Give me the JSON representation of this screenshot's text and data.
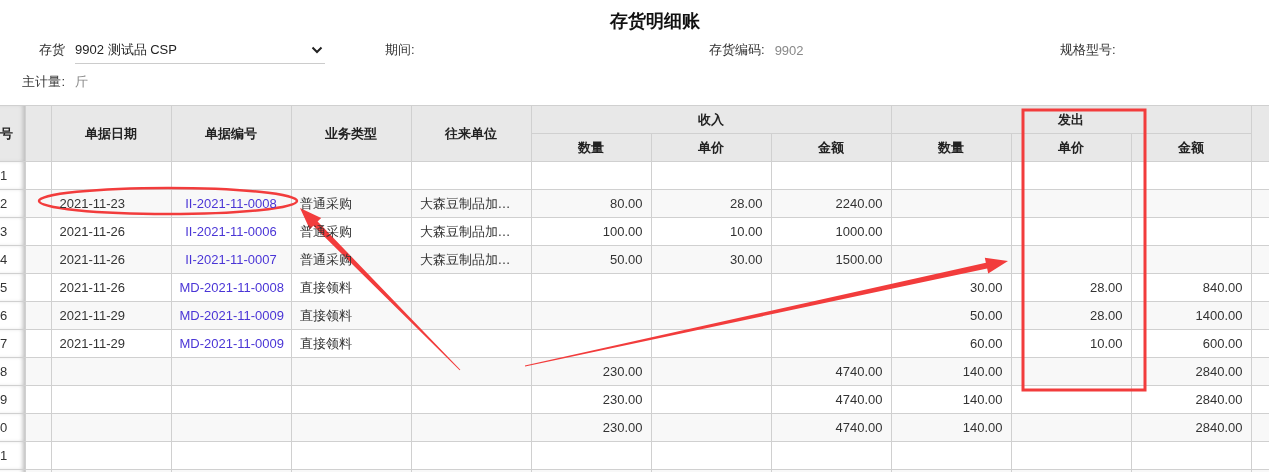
{
  "title": "存货明细账",
  "filters": {
    "inventory": {
      "label": "存货",
      "value": "9902 测试品 CSP"
    },
    "period": {
      "label": "期间:"
    },
    "code": {
      "label": "存货编码:",
      "value": "9902"
    },
    "spec": {
      "label": "规格型号:"
    },
    "unit": {
      "label": "主计量:",
      "value": "斤"
    }
  },
  "table": {
    "row_number_header": "号",
    "columns": [
      "单据日期",
      "单据编号",
      "业务类型",
      "往来单位"
    ],
    "groups": [
      {
        "label": "收入",
        "columns": [
          "数量",
          "单价",
          "金额"
        ]
      },
      {
        "label": "发出",
        "columns": [
          "数量",
          "单价",
          "金额"
        ]
      }
    ],
    "rows": [
      {
        "no": "1"
      },
      {
        "no": "2",
        "date": "2021-11-23",
        "doc_no": "II-2021-11-0008",
        "type": "普通采购",
        "partner": "大森豆制品加…",
        "in_qty": "80.00",
        "in_price": "28.00",
        "in_amount": "2240.00"
      },
      {
        "no": "3",
        "date": "2021-11-26",
        "doc_no": "II-2021-11-0006",
        "type": "普通采购",
        "partner": "大森豆制品加…",
        "in_qty": "100.00",
        "in_price": "10.00",
        "in_amount": "1000.00"
      },
      {
        "no": "4",
        "date": "2021-11-26",
        "doc_no": "II-2021-11-0007",
        "type": "普通采购",
        "partner": "大森豆制品加…",
        "in_qty": "50.00",
        "in_price": "30.00",
        "in_amount": "1500.00"
      },
      {
        "no": "5",
        "date": "2021-11-26",
        "doc_no": "MD-2021-11-0008",
        "type": "直接领料",
        "out_qty": "30.00",
        "out_price": "28.00",
        "out_amount": "840.00"
      },
      {
        "no": "6",
        "date": "2021-11-29",
        "doc_no": "MD-2021-11-0009",
        "type": "直接领料",
        "out_qty": "50.00",
        "out_price": "28.00",
        "out_amount": "1400.00"
      },
      {
        "no": "7",
        "date": "2021-11-29",
        "doc_no": "MD-2021-11-0009",
        "type": "直接领料",
        "out_qty": "60.00",
        "out_price": "10.00",
        "out_amount": "600.00"
      },
      {
        "no": "8",
        "in_qty": "230.00",
        "in_amount": "4740.00",
        "out_qty": "140.00",
        "out_amount": "2840.00"
      },
      {
        "no": "9",
        "in_qty": "230.00",
        "in_amount": "4740.00",
        "out_qty": "140.00",
        "out_amount": "2840.00"
      },
      {
        "no": "0",
        "in_qty": "230.00",
        "in_amount": "4740.00",
        "out_qty": "140.00",
        "out_amount": "2840.00"
      },
      {
        "no": "1"
      }
    ]
  },
  "annotations": [
    {
      "kind": "ellipse"
    },
    {
      "kind": "arrow"
    },
    {
      "kind": "arrow"
    },
    {
      "kind": "rectangle"
    }
  ]
}
